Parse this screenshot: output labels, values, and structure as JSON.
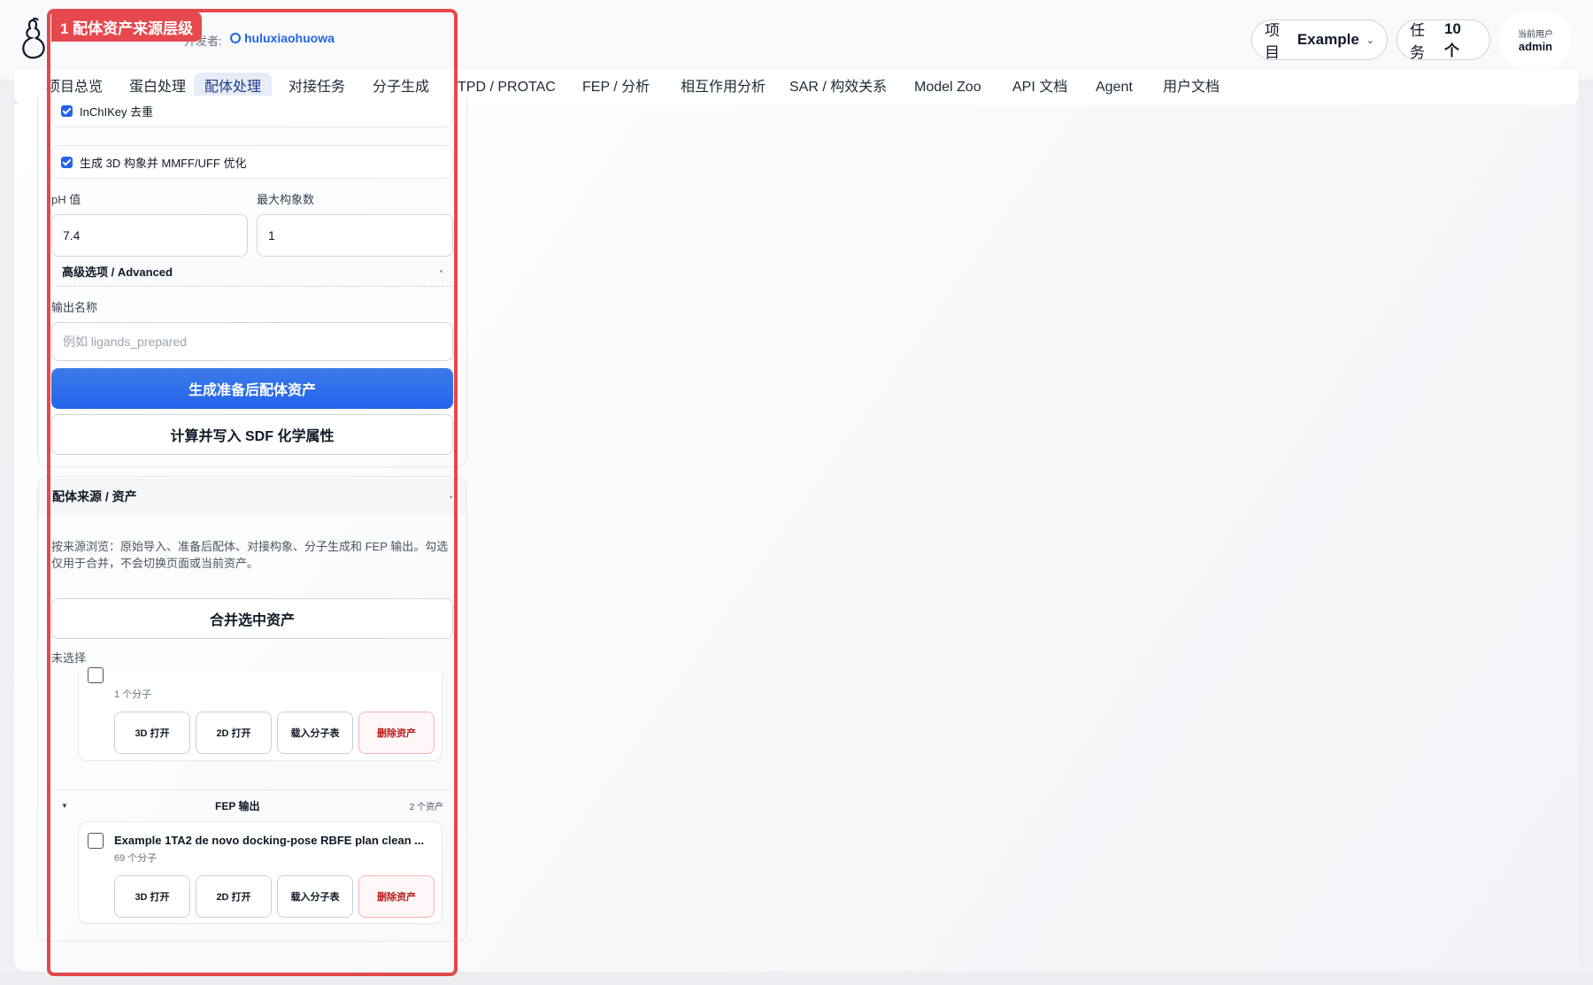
{
  "header": {
    "developer_label": "开发者:",
    "developer_link": "huluxiaohuowa",
    "project_label": "项目",
    "project_value": "Example",
    "tasks_label": "任务",
    "tasks_value": "10 个",
    "user_label": "当前用户",
    "user_name": "admin"
  },
  "nav": {
    "tabs": [
      {
        "label": "项目总览"
      },
      {
        "label": "蛋白处理"
      },
      {
        "label": "配体处理"
      },
      {
        "label": "对接任务"
      },
      {
        "label": "分子生成"
      },
      {
        "label": "TPD / PROTAC"
      },
      {
        "label": "FEP / 分析"
      },
      {
        "label": "相互作用分析"
      },
      {
        "label": "SAR / 构效关系"
      },
      {
        "label": "Model Zoo"
      },
      {
        "label": "API 文档"
      },
      {
        "label": "Agent"
      },
      {
        "label": "用户文档"
      }
    ]
  },
  "prep": {
    "inchikey_dedup": "InChIKey 去重",
    "gen_3d": "生成 3D 构象并 MMFF/UFF 优化",
    "ph_label": "pH 值",
    "ph_value": "7.4",
    "max_conf_label": "最大构象数",
    "max_conf_value": "1",
    "advanced": "高级选项 / Advanced",
    "output_name_label": "输出名称",
    "output_name_placeholder": "例如 ligands_prepared",
    "generate_button": "生成准备后配体资产",
    "compute_button": "计算并写入 SDF 化学属性"
  },
  "sources": {
    "title": "配体来源 / 资产",
    "description": "按来源浏览：原始导入、准备后配体、对接构象、分子生成和 FEP 输出。勾选仅用于合并，不会切换页面或当前资产。",
    "merge_button": "合并选中资产",
    "selection_status": "未选择",
    "asset_prev": {
      "count": "1 个分子",
      "btn_3d": "3D 打开",
      "btn_2d": "2D 打开",
      "btn_table": "载入分子表",
      "btn_delete": "删除资产"
    },
    "fep_group": {
      "title": "FEP 输出",
      "count": "2 个资产"
    },
    "asset_fep": {
      "title": "Example 1TA2 de novo docking-pose RBFE plan clean ...",
      "count": "69 个分子",
      "btn_3d": "3D 打开",
      "btn_2d": "2D 打开",
      "btn_table": "载入分子表",
      "btn_delete": "删除资产"
    }
  },
  "annotation": {
    "tag": "1 配体资产来源层级"
  },
  "colors": {
    "primary": "#2563eb",
    "annotation": "#e5484d",
    "danger": "#b91c1c"
  }
}
